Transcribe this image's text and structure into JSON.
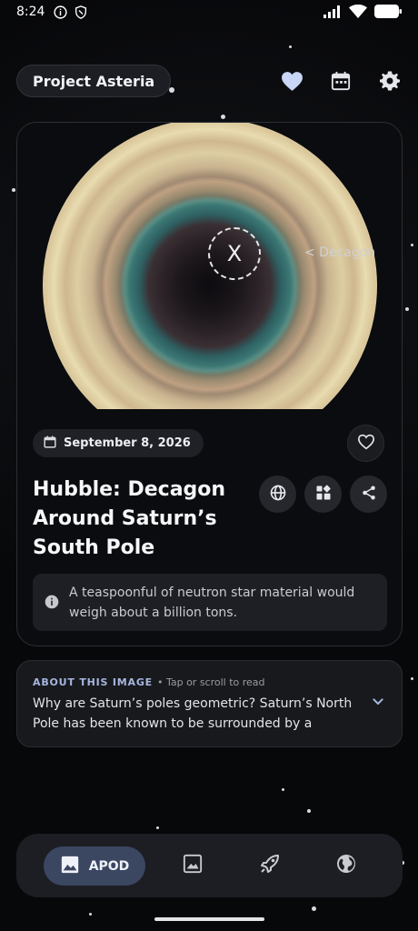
{
  "status_bar": {
    "time": "8:24"
  },
  "header": {
    "project_name": "Project Asteria"
  },
  "card": {
    "annotation_marker": "X",
    "annotation_label": "< Decagon",
    "date": "September 8, 2026",
    "title": "Hubble: Decagon Around Saturn’s South Pole",
    "fact": "A teaspoonful of neutron star material would weigh about a billion tons."
  },
  "about": {
    "heading": "ABOUT THIS IMAGE",
    "hint": "• Tap or scroll to read",
    "text": "Why are Saturn’s poles geometric? Saturn’s North Pole has been known to be surrounded by a hexag..."
  },
  "nav": {
    "active_label": "APOD",
    "items": [
      "apod-icon",
      "gallery-icon",
      "rocket-icon",
      "globe-icon"
    ]
  },
  "colors": {
    "accent": "#3b4661",
    "accent_text": "#a7b6de",
    "background": "#0b0c0f"
  }
}
